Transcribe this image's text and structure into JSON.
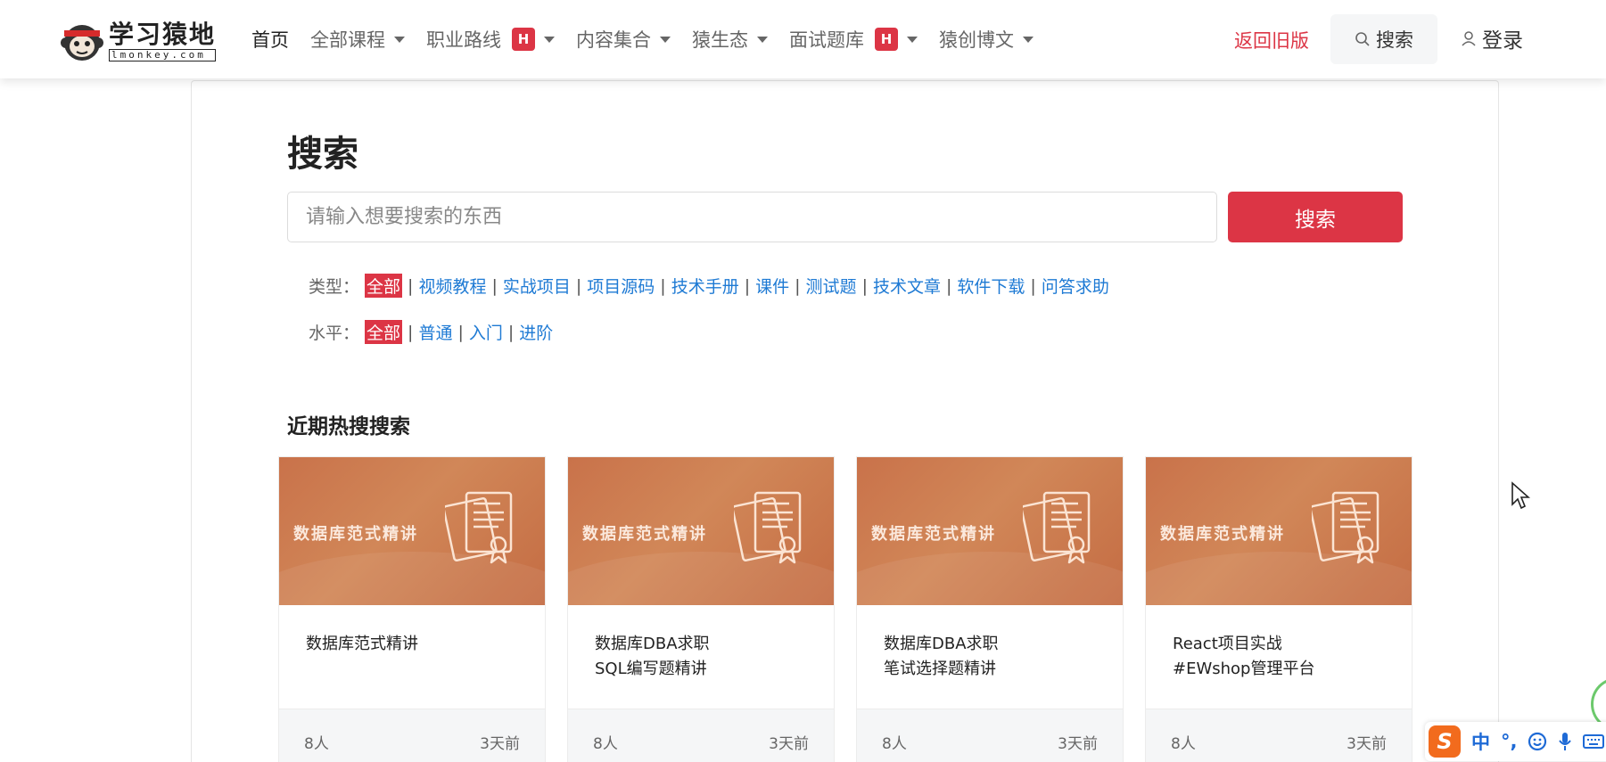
{
  "brand": {
    "logo_cn": "学习猿地",
    "logo_en": "lmonkey.com"
  },
  "nav": {
    "items": [
      {
        "label": "首页",
        "caret": false,
        "hot": false,
        "active": true
      },
      {
        "label": "全部课程",
        "caret": true,
        "hot": false
      },
      {
        "label": "职业路线",
        "caret": true,
        "hot": true
      },
      {
        "label": "内容集合",
        "caret": true,
        "hot": false
      },
      {
        "label": "猿生态",
        "caret": true,
        "hot": false
      },
      {
        "label": "面试题库",
        "caret": true,
        "hot": true
      },
      {
        "label": "猿创博文",
        "caret": true,
        "hot": false
      }
    ],
    "hot_badge": "H",
    "old_version": "返回旧版",
    "search": "搜索",
    "login": "登录"
  },
  "page": {
    "title": "搜索",
    "search_placeholder": "请输入想要搜索的东西",
    "search_button": "搜索"
  },
  "filters": {
    "type": {
      "label": "类型：",
      "options": [
        "全部",
        "视频教程",
        "实战项目",
        "项目源码",
        "技术手册",
        "课件",
        "测试题",
        "技术文章",
        "软件下载",
        "问答求助"
      ],
      "active": 0
    },
    "level": {
      "label": "水平：",
      "options": [
        "全部",
        "普通",
        "入门",
        "进阶"
      ],
      "active": 0
    },
    "separator": "|"
  },
  "hot_section": {
    "title": "近期热搜搜索",
    "cards": [
      {
        "cover_text": "数据库范式精讲",
        "title": "数据库范式精讲",
        "learners": "8人",
        "time": "3天前"
      },
      {
        "cover_text": "数据库范式精讲",
        "title": "数据库DBA求职\nSQL编写题精讲",
        "learners": "8人",
        "time": "3天前"
      },
      {
        "cover_text": "数据库范式精讲",
        "title": "数据库DBA求职\n笔试选择题精讲",
        "learners": "8人",
        "time": "3天前"
      },
      {
        "cover_text": "数据库范式精讲",
        "title": "React项目实战\n#EWshop管理平台",
        "learners": "8人",
        "time": "3天前"
      }
    ]
  },
  "ime": {
    "logo": "S",
    "lang": "中",
    "punct": "°,"
  },
  "colors": {
    "accent": "#dc3545",
    "link": "#1e7ad4",
    "cover": "#c9724a"
  }
}
